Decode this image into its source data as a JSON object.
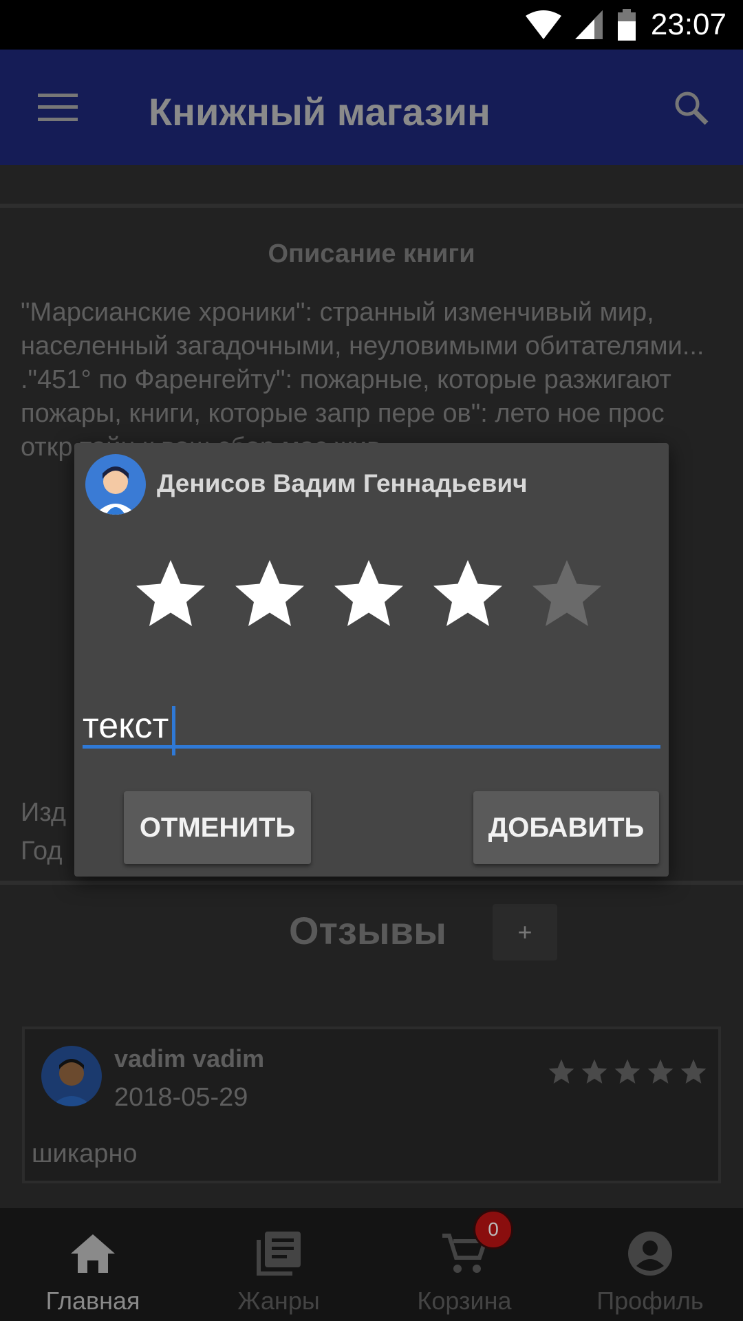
{
  "status_bar": {
    "time": "23:07",
    "icons": [
      "wifi-icon",
      "cell-signal-icon",
      "battery-icon"
    ]
  },
  "app_bar": {
    "title": "Книжный магазин",
    "icons": [
      "menu-icon",
      "search-icon"
    ]
  },
  "book": {
    "description_title": "Описание книги",
    "description_text": "\"Марсианские хроники\": странный изменчивый мир, населенный загадочными, неуловимыми обитателями... .\"451° по Фаренгейту\": пожарные, которые разжигают пожары, книги, которые запр                                                                         пере                                                                         ов\": лето                                                                             ное прос                                                                                  откр                                                                                     тайн                                                                                 к вош                                                                                  сбор                                                                                        мас                                                                                        жив",
    "meta_publisher": "Изд",
    "meta_year": "Год"
  },
  "reviews": {
    "title": "Отзывы",
    "add_label": "+",
    "items": [
      {
        "author": "vadim vadim",
        "date": "2018-05-29",
        "rating": 5,
        "text": "шикарно"
      }
    ]
  },
  "dialog": {
    "user_name": "Денисов Вадим Геннадьевич",
    "rating": 4,
    "max_rating": 5,
    "text_value": "текст",
    "cancel_label": "ОТМЕНИТЬ",
    "add_label": "ДОБАВИТЬ",
    "accent_color": "#2f79d6"
  },
  "bottom_nav": {
    "items": [
      {
        "label": "Главная",
        "icon": "home-icon",
        "active": true
      },
      {
        "label": "Жанры",
        "icon": "library-icon",
        "active": false
      },
      {
        "label": "Корзина",
        "icon": "cart-icon",
        "active": false
      },
      {
        "label": "Профиль",
        "icon": "account-icon",
        "active": false
      }
    ],
    "cart_badge": "0"
  }
}
